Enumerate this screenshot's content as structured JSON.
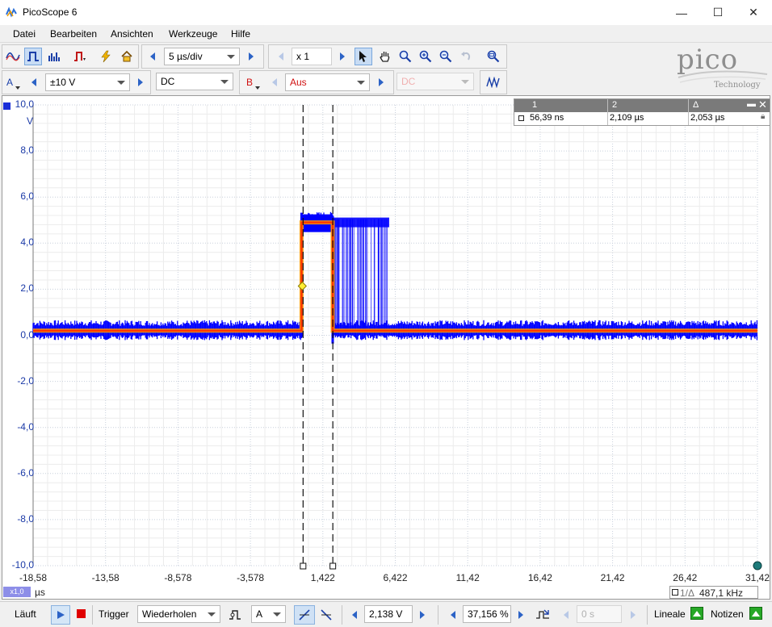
{
  "window": {
    "title": "PicoScope 6",
    "minimize": "—",
    "maximize": "☐",
    "close": "✕"
  },
  "menu": [
    "Datei",
    "Bearbeiten",
    "Ansichten",
    "Werkzeuge",
    "Hilfe"
  ],
  "toolbar1": {
    "timebase": "5 µs/div",
    "zoom": "x 1"
  },
  "toolbar2": {
    "channel_a_label": "A",
    "channel_a_range": "±10 V",
    "channel_a_coupling": "DC",
    "channel_b_label": "B",
    "channel_b_range": "Aus",
    "channel_b_coupling": "DC"
  },
  "logo": {
    "text": "pico",
    "sub": "Technology"
  },
  "cursor_table": {
    "headers": [
      "1",
      "2",
      "Δ"
    ],
    "values": [
      "56,39 ns",
      "2,109 µs",
      "2,053 µs"
    ]
  },
  "scope": {
    "y_unit": "V",
    "x_unit": "µs",
    "x_scale_badge": "x1,0",
    "freq_readout": "487,1 kHz",
    "freq_prefix": "1/Δ"
  },
  "chart_data": {
    "type": "line",
    "ylim": [
      -10,
      10
    ],
    "xlim": [
      -18.58,
      31.42
    ],
    "y_ticks": [
      "10,0",
      "8,0",
      "6,0",
      "4,0",
      "2,0",
      "0,0",
      "-2,0",
      "-4,0",
      "-6,0",
      "-8,0",
      "-10,0"
    ],
    "x_ticks": [
      "-18,58",
      "-13,58",
      "-8,578",
      "-3,578",
      "1,422",
      "6,422",
      "11,42",
      "16,42",
      "21,42",
      "26,42",
      "31,42"
    ],
    "series": [
      {
        "color": "#0000ff",
        "x": [
          -18.58,
          -0.05,
          0.0,
          2.1,
          2.15,
          31.42
        ],
        "y": [
          0.2,
          0.2,
          4.9,
          4.9,
          0.2,
          0.2
        ]
      }
    ],
    "cursors_x": [
      0.056,
      2.109
    ],
    "trigger": {
      "x": 0.0,
      "y": 2.138
    }
  },
  "status": {
    "run_label": "Läuft",
    "trigger_label": "Trigger",
    "trigger_mode": "Wiederholen",
    "trigger_channel": "A",
    "trigger_level": "2,138 V",
    "pre_trigger": "37,156 %",
    "delay": "0 s",
    "rulers_label": "Lineale",
    "notes_label": "Notizen"
  },
  "colors": {
    "trace": "#0000ff",
    "persist_hot": "#ff3300",
    "axis_text": "#1b3aa7"
  }
}
